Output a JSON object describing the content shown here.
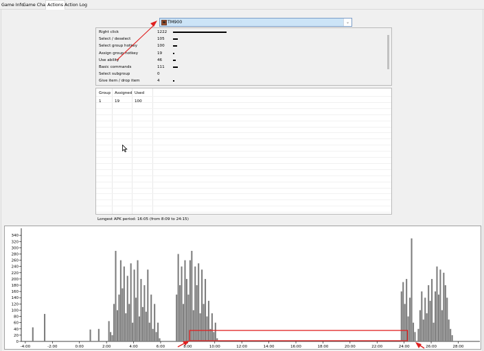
{
  "tabs": [
    {
      "label": "Game Info"
    },
    {
      "label": "Game Chat"
    },
    {
      "label": "Actions"
    },
    {
      "label": "Action Log"
    }
  ],
  "player_select": {
    "value": "TM900",
    "icon": "player-portrait-icon"
  },
  "actions": [
    {
      "name": "Right click",
      "count": 1222
    },
    {
      "name": "Select / deselect",
      "count": 105
    },
    {
      "name": "Select group hotkey",
      "count": 100
    },
    {
      "name": "Assign group hotkey",
      "count": 19
    },
    {
      "name": "Use ability",
      "count": 46
    },
    {
      "name": "Basic commands",
      "count": 111
    },
    {
      "name": "Select subgroup",
      "count": 0
    },
    {
      "name": "Give item / drop item",
      "count": 4
    }
  ],
  "groups": {
    "headers": [
      "Group",
      "Assigned",
      "Used"
    ],
    "rows": [
      [
        "1",
        "19",
        "100"
      ]
    ]
  },
  "longest_apm": "Longest APK period: 16:05 (from 8:09 to 24:15)",
  "colors": {
    "bar": "#7d7d7d",
    "highlight": "#e02020",
    "select": "#cce4f7"
  },
  "chart_data": {
    "type": "bar",
    "yticks": [
      0,
      20,
      40,
      60,
      80,
      100,
      120,
      140,
      160,
      180,
      200,
      220,
      240,
      260,
      280,
      300,
      320,
      340
    ],
    "ylim": [
      0,
      350
    ],
    "xticks": [
      "-4:00",
      "-2:00",
      "0:00",
      "2:00",
      "4:00",
      "6:00",
      "8:00",
      "10:00",
      "12:00",
      "14:00",
      "16:00",
      "18:00",
      "20:00",
      "22:00",
      "24:00",
      "26:00",
      "28:00"
    ],
    "xlim_minutes": [
      -4.3,
      29.6
    ],
    "series": [
      {
        "values_from": -3.5,
        "step": 0.125,
        "values": [
          45,
          0,
          0,
          0,
          0,
          0,
          0,
          88,
          0,
          0,
          0,
          0,
          0,
          0,
          0,
          0,
          0,
          0,
          0,
          0,
          0,
          0,
          0,
          0,
          0,
          0,
          0,
          0,
          0,
          0,
          0,
          0,
          0,
          0,
          38,
          0,
          0,
          0,
          0,
          40,
          0,
          0,
          0,
          0,
          0,
          65,
          30,
          20,
          120,
          290,
          100,
          150,
          260,
          170,
          240,
          90,
          210,
          120,
          250,
          60,
          230,
          140,
          260,
          80,
          200,
          110,
          180,
          95,
          230,
          60,
          150,
          40,
          120,
          30,
          60,
          10,
          0,
          0,
          0,
          0,
          0,
          0,
          0,
          0,
          0,
          150,
          280,
          180,
          240,
          120,
          260,
          200,
          150,
          260,
          290,
          100,
          240,
          180,
          250,
          90,
          230,
          120,
          200,
          80,
          130,
          40,
          90,
          30,
          60,
          10,
          0,
          0,
          0,
          0,
          0,
          0,
          0,
          0,
          0,
          0,
          0,
          0,
          0,
          0,
          0,
          0,
          0,
          0,
          0,
          0,
          0,
          0,
          0,
          0,
          0,
          0,
          0,
          0,
          0,
          0,
          0,
          0,
          0,
          0,
          0,
          0,
          0,
          0,
          0,
          0,
          0,
          0,
          0,
          0,
          0,
          0,
          0,
          0,
          0,
          0,
          0,
          0,
          0,
          0,
          0,
          0,
          0,
          0,
          0,
          0,
          0,
          0,
          0,
          0,
          0,
          0,
          0,
          0,
          0,
          0,
          0,
          0,
          0,
          0,
          0,
          0,
          0,
          0,
          0,
          0,
          0,
          0,
          0,
          0,
          0,
          0,
          0,
          0,
          0,
          0,
          0,
          0,
          0,
          0,
          0,
          0,
          0,
          0,
          0,
          0,
          0,
          0,
          0,
          0,
          0,
          0,
          0,
          0,
          160,
          190,
          120,
          200,
          80,
          140,
          330,
          60,
          30,
          0,
          40,
          100,
          160,
          70,
          140,
          90,
          180,
          130,
          200,
          60,
          160,
          240,
          150,
          230,
          100,
          220,
          180,
          140,
          70,
          40,
          20
        ]
      }
    ],
    "highlight_range": [
      "8:09",
      "24:15"
    ]
  }
}
